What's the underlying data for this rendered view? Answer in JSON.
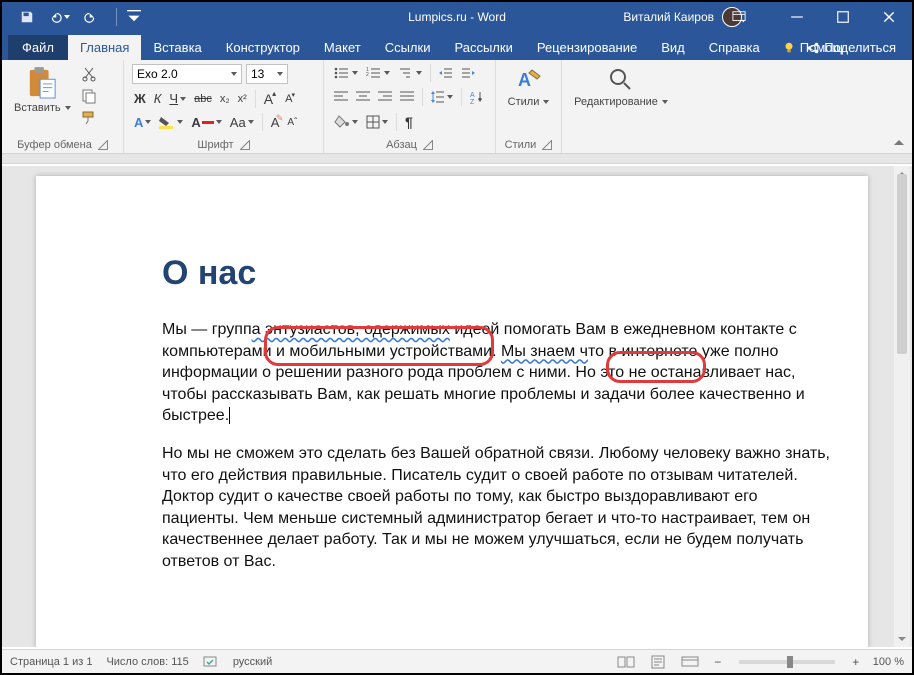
{
  "titlebar": {
    "document": "Lumpics.ru  -  Word",
    "user": "Виталий Каиров"
  },
  "tabs": {
    "file": "Файл",
    "items": [
      "Главная",
      "Вставка",
      "Конструктор",
      "Макет",
      "Ссылки",
      "Рассылки",
      "Рецензирование",
      "Вид",
      "Справка"
    ],
    "active_index": 0,
    "help": "Помощ",
    "share": "Поделиться"
  },
  "ribbon": {
    "clipboard": {
      "paste": "Вставить",
      "label": "Буфер обмена"
    },
    "font": {
      "name": "Exo 2.0",
      "size": "13",
      "B": "Ж",
      "I": "К",
      "U": "Ч",
      "strike_icon": "abc",
      "sub": "x₂",
      "sup": "x²",
      "A_big": "A",
      "A_small": "A",
      "Aa": "Aa",
      "label": "Шрифт"
    },
    "paragraph": {
      "label": "Абзац"
    },
    "styles": {
      "btn": "Стили",
      "label": "Стили"
    },
    "editing": {
      "btn": "Редактирование"
    }
  },
  "document": {
    "heading": "О нас",
    "p1_a": "Мы — групп",
    "p1_wavy1": "а энтузиастов,  одержимых",
    "p1_b": " идеей помогать Вам в ежедневном контакте с компьютерами и мобильными устройствами. ",
    "p1_wavy2": "Мы знаем ч",
    "p1_c": "то в интернете уже полно информации о решении разного рода проблем с ними. Но это не останавливает нас, чтобы рассказывать Вам, как решать многие проблемы и задачи более качественно и быстрее.",
    "p2": "Но мы не сможем это сделать без Вашей обратной связи. Любому человеку важно знать, что его действия правильные. Писатель судит о своей работе по отзывам читателей. Доктор судит о качестве своей работы по тому, как быстро выздоравливают его пациенты. Чем меньше системный администратор бегает и что-то настраивает, тем он качественнее делает работу. Так и мы не можем улучшаться, если не будем получать ответов от Вас."
  },
  "statusbar": {
    "page": "Страница 1 из 1",
    "words": "Число слов: 115",
    "lang": "русский",
    "zoom": "100 %"
  }
}
